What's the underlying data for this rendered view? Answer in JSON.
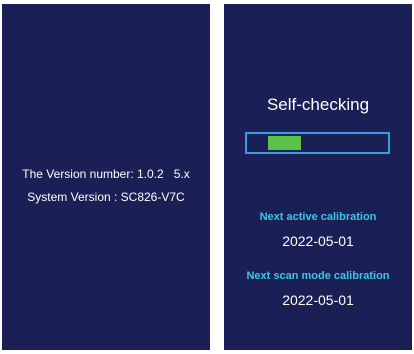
{
  "left_screen": {
    "version_line": "The Version number: 1.0.2   5.x",
    "system_version_line": "System Version : SC826-V7C"
  },
  "right_screen": {
    "title": "Self-checking",
    "progress": {
      "filled_segment_start": 0.15,
      "filled_segment_end": 0.38,
      "fill_color": "#5cc24a",
      "border_color": "#3b9be0"
    },
    "next_active_calibration_label": "Next active calibration",
    "next_active_calibration_date": "2022-05-01",
    "next_scan_mode_calibration_label": "Next scan mode calibration",
    "next_scan_mode_calibration_date": "2022-05-01"
  },
  "colors": {
    "screen_background": "#1a1f55",
    "label_accent": "#3ec6e6",
    "text": "#ffffff"
  }
}
